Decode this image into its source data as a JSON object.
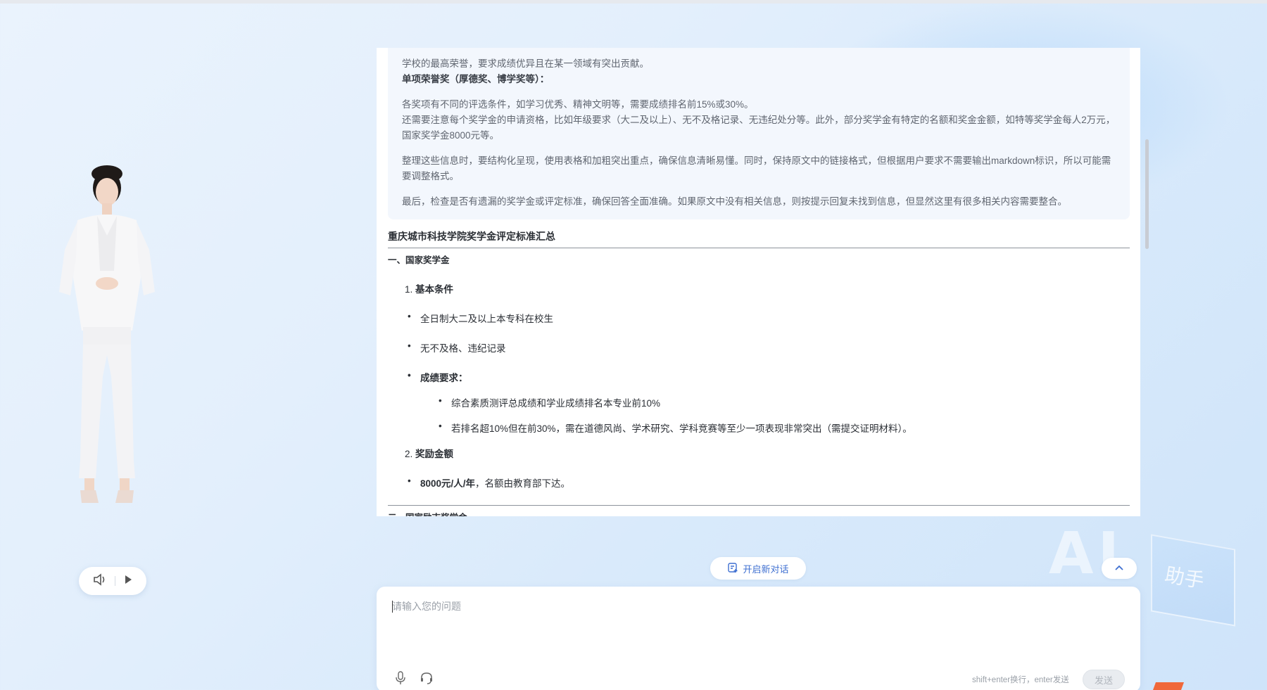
{
  "decor": {
    "ai_text": "AI",
    "assistant_text": "助手"
  },
  "thinking": {
    "line1": "学校的最高荣誉，要求成绩优异且在某一领域有突出贡献。",
    "line2": "单项荣誉奖（厚德奖、博学奖等）：",
    "para1": "各奖项有不同的评选条件，如学习优秀、精神文明等，需要成绩排名前15%或30%。",
    "para2": "还需要注意每个奖学金的申请资格，比如年级要求（大二及以上）、无不及格记录、无违纪处分等。此外，部分奖学金有特定的名额和奖金金额，如特等奖学金每人2万元，国家奖学金8000元等。",
    "para3": "整理这些信息时，要结构化呈现，使用表格和加粗突出重点，确保信息清晰易懂。同时，保持原文中的链接格式，但根据用户要求不需要输出markdown标识，所以可能需要调整格式。",
    "para4": "最后，检查是否有遗漏的奖学金或评定标准，确保回答全面准确。如果原文中没有相关信息，则按提示回复未找到信息，但显然这里有很多相关内容需要整合。"
  },
  "answer": {
    "title": "重庆城市科技学院奖学金评定标准汇总",
    "section1": "一、国家奖学金",
    "item1_num": "1.",
    "item1": "基本条件",
    "b1": "全日制大二及以上本专科在校生",
    "b2": "无不及格、违纪记录",
    "b3": "成绩要求：",
    "s1": "综合素质测评总成绩和学业成绩排名本专业前10%",
    "s2": "若排名超10%但在前30%，需在道德风尚、学术研究、学科竞赛等至少一项表现非常突出（需提交证明材料）。",
    "item2_num": "2.",
    "item2": "奖励金额",
    "amount_bold": "8000元/人/年",
    "amount_rest": "，名额由教育部下达。",
    "section2": "二、国家励志奖学金"
  },
  "actions": {
    "new_chat": "开启新对话"
  },
  "input": {
    "placeholder": "请输入您的问题",
    "hint": "shift+enter换行，enter发送",
    "send": "发送"
  },
  "icons": [
    "volume-icon",
    "play-icon",
    "new-chat-icon",
    "chevron-up-icon",
    "mic-icon",
    "headset-icon"
  ]
}
